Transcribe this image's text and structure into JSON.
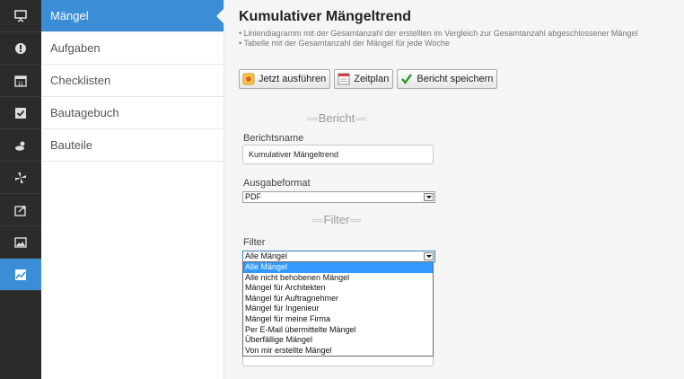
{
  "rail": {
    "items": [
      {
        "icon": "presentation-icon",
        "active": false
      },
      {
        "icon": "alert-circle-icon",
        "active": false
      },
      {
        "icon": "calendar-icon",
        "active": false
      },
      {
        "icon": "checkbox-icon",
        "active": false
      },
      {
        "icon": "weather-icon",
        "active": false
      },
      {
        "icon": "pinwheel-icon",
        "active": false
      },
      {
        "icon": "export-icon",
        "active": false
      },
      {
        "icon": "image-icon",
        "active": false
      },
      {
        "icon": "chart-trend-icon",
        "active": true
      }
    ]
  },
  "nav": {
    "items": [
      {
        "label": "Mängel",
        "active": true
      },
      {
        "label": "Aufgaben",
        "active": false
      },
      {
        "label": "Checklisten",
        "active": false
      },
      {
        "label": "Bautagebuch",
        "active": false
      },
      {
        "label": "Bauteile",
        "active": false
      }
    ]
  },
  "report": {
    "title": "Kumulativer Mängeltrend",
    "desc_line1": "• Liniendiagramm mit der Gesamtanzahl der erstellten im Vergleich zur Gesamtanzahl abgeschlossener Mängel",
    "desc_line2": "• Tabelle mit der Gesamtanzahl der Mängel für jede Woche"
  },
  "toolbar": {
    "run_label": "Jetzt ausführen",
    "schedule_label": "Zeitplan",
    "save_label": "Bericht speichern"
  },
  "form": {
    "section_report": "Bericht",
    "name_label": "Berichtsname",
    "name_value": "Kumulativer Mängeltrend",
    "format_label": "Ausgabeformat",
    "format_value": "PDF",
    "section_filter": "Filter",
    "filter_label": "Filter",
    "filter_value": "Alle Mängel",
    "filter_options": [
      "Alle Mängel",
      "Alle nicht behobenen Mängel",
      "Mängel für Architekten",
      "Mängel für Auftragnehmer",
      "Mängel für Ingenieur",
      "Mängel für meine Firma",
      "Per E-Mail übermittelte Mängel",
      "Überfällige Mängel",
      "Von mir erstellte Mängel"
    ]
  },
  "colors": {
    "accent": "#3b8ed6",
    "rail_bg": "#2b2b2b",
    "selected_option": "#3399ff"
  }
}
